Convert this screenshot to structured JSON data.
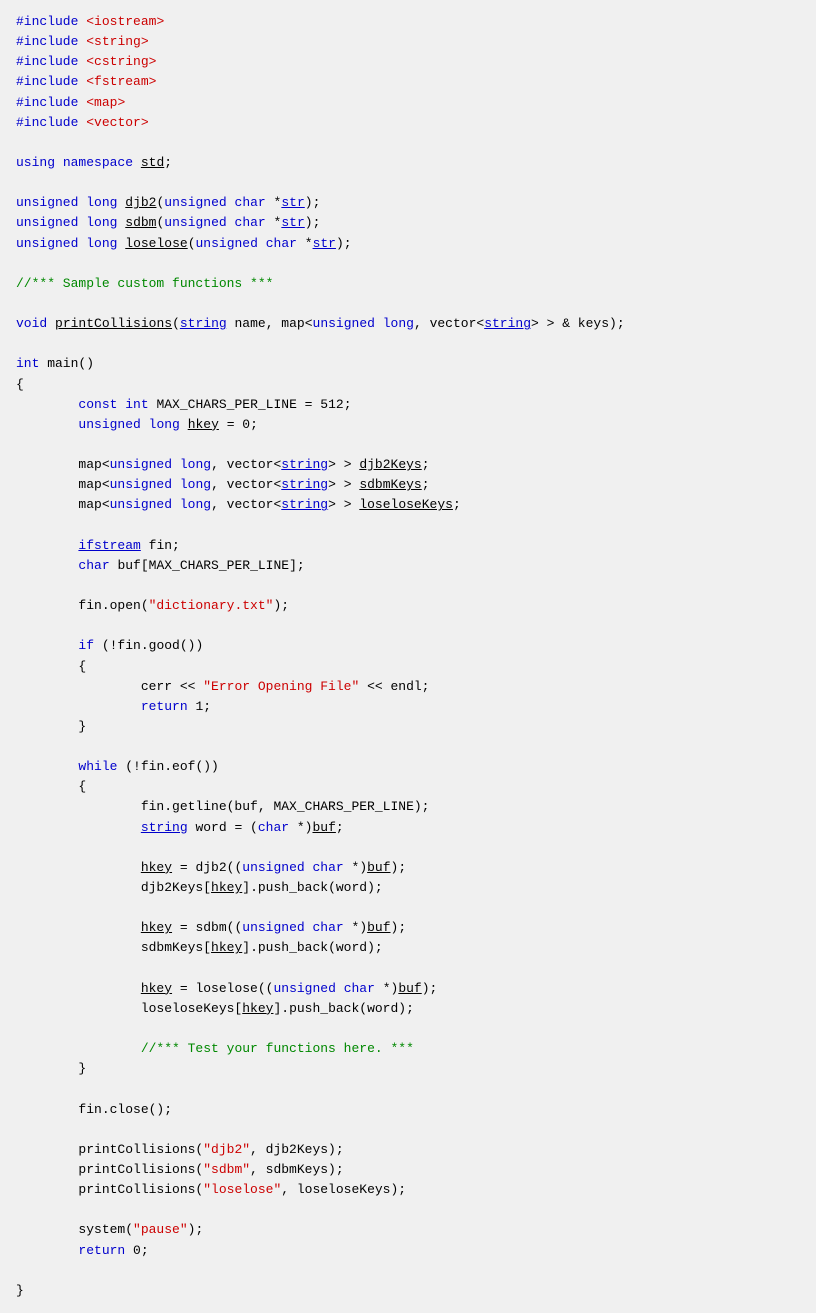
{
  "code": {
    "lines": [
      {
        "id": "l1",
        "content": "#include <iostream>"
      },
      {
        "id": "l2",
        "content": "#include <string>"
      },
      {
        "id": "l3",
        "content": "#include <cstring>"
      },
      {
        "id": "l4",
        "content": "#include <fstream>"
      },
      {
        "id": "l5",
        "content": "#include <map>"
      },
      {
        "id": "l6",
        "content": "#include <vector>"
      },
      {
        "id": "l7",
        "content": ""
      },
      {
        "id": "l8",
        "content": "using namespace std;"
      },
      {
        "id": "l9",
        "content": ""
      },
      {
        "id": "l10",
        "content": "unsigned long djb2(unsigned char *str);"
      },
      {
        "id": "l11",
        "content": "unsigned long sdbm(unsigned char *str);"
      },
      {
        "id": "l12",
        "content": "unsigned long loselose(unsigned char *str);"
      },
      {
        "id": "l13",
        "content": ""
      },
      {
        "id": "l14",
        "content": "//*** Sample custom functions ***"
      },
      {
        "id": "l15",
        "content": ""
      },
      {
        "id": "l16",
        "content": "void printCollisions(string name, map<unsigned long, vector<string> > & keys);"
      },
      {
        "id": "l17",
        "content": ""
      },
      {
        "id": "l18",
        "content": "int main()"
      },
      {
        "id": "l19",
        "content": "{"
      },
      {
        "id": "l20",
        "content": "    const int MAX_CHARS_PER_LINE = 512;"
      },
      {
        "id": "l21",
        "content": "    unsigned long hkey = 0;"
      },
      {
        "id": "l22",
        "content": ""
      },
      {
        "id": "l23",
        "content": "    map<unsigned long, vector<string> > djb2Keys;"
      },
      {
        "id": "l24",
        "content": "    map<unsigned long, vector<string> > sdbmKeys;"
      },
      {
        "id": "l25",
        "content": "    map<unsigned long, vector<string> > loseloseKeys;"
      },
      {
        "id": "l26",
        "content": ""
      },
      {
        "id": "l27",
        "content": "    ifstream fin;"
      },
      {
        "id": "l28",
        "content": "    char buf[MAX_CHARS_PER_LINE];"
      },
      {
        "id": "l29",
        "content": ""
      },
      {
        "id": "l30",
        "content": "    fin.open(\"dictionary.txt\");"
      },
      {
        "id": "l31",
        "content": ""
      },
      {
        "id": "l32",
        "content": "    if (!fin.good())"
      },
      {
        "id": "l33",
        "content": "    {"
      },
      {
        "id": "l34",
        "content": "        cerr << \"Error Opening File\" << endl;"
      },
      {
        "id": "l35",
        "content": "        return 1;"
      },
      {
        "id": "l36",
        "content": "    }"
      },
      {
        "id": "l37",
        "content": ""
      },
      {
        "id": "l38",
        "content": "    while (!fin.eof())"
      },
      {
        "id": "l39",
        "content": "    {"
      },
      {
        "id": "l40",
        "content": "        fin.getline(buf, MAX_CHARS_PER_LINE);"
      },
      {
        "id": "l41",
        "content": "        string word = (char *)buf;"
      },
      {
        "id": "l42",
        "content": ""
      },
      {
        "id": "l43",
        "content": "        hkey = djb2((unsigned char *)buf);"
      },
      {
        "id": "l44",
        "content": "        djb2Keys[hkey].push_back(word);"
      },
      {
        "id": "l45",
        "content": ""
      },
      {
        "id": "l46",
        "content": "        hkey = sdbm((unsigned char *)buf);"
      },
      {
        "id": "l47",
        "content": "        sdbmKeys[hkey].push_back(word);"
      },
      {
        "id": "l48",
        "content": ""
      },
      {
        "id": "l49",
        "content": "        hkey = loselose((unsigned char *)buf);"
      },
      {
        "id": "l50",
        "content": "        loseloseKeys[hkey].push_back(word);"
      },
      {
        "id": "l51",
        "content": ""
      },
      {
        "id": "l52",
        "content": "        //*** Test your functions here. ***"
      },
      {
        "id": "l53",
        "content": "    }"
      },
      {
        "id": "l54",
        "content": ""
      },
      {
        "id": "l55",
        "content": "    fin.close();"
      },
      {
        "id": "l56",
        "content": ""
      },
      {
        "id": "l57",
        "content": "    printCollisions(\"djb2\", djb2Keys);"
      },
      {
        "id": "l58",
        "content": "    printCollisions(\"sdbm\", sdbmKeys);"
      },
      {
        "id": "l59",
        "content": "    printCollisions(\"loselose\", loseloseKeys);"
      },
      {
        "id": "l60",
        "content": ""
      },
      {
        "id": "l61",
        "content": "    system(\"pause\");"
      },
      {
        "id": "l62",
        "content": "    return 0;"
      },
      {
        "id": "l63",
        "content": ""
      },
      {
        "id": "l64",
        "content": "}"
      }
    ]
  }
}
